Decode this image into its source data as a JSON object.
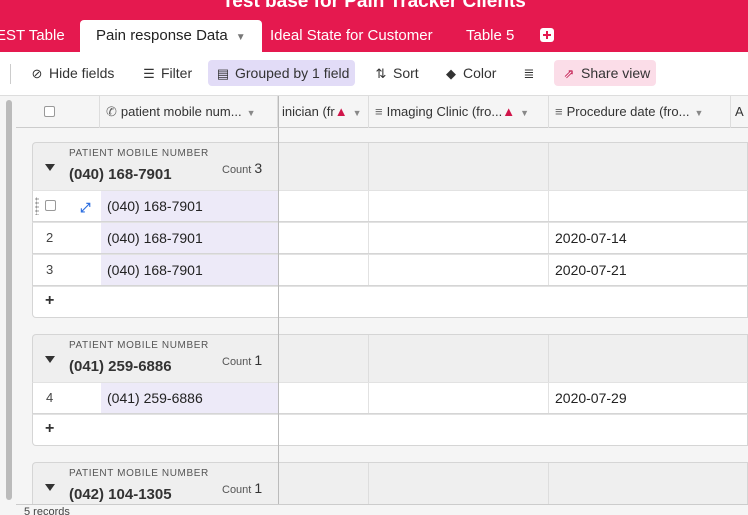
{
  "app": {
    "title": "Test base for Pain Tracker Clients"
  },
  "tabs": [
    {
      "label": "EST Table"
    },
    {
      "label": "Pain response Data"
    },
    {
      "label": "Ideal State for Customer"
    },
    {
      "label": "Table 5"
    }
  ],
  "toolbar": {
    "hide_fields": "Hide fields",
    "filter": "Filter",
    "grouped": "Grouped by 1 field",
    "sort": "Sort",
    "color": "Color",
    "share": "Share view"
  },
  "columns": [
    {
      "label": "patient mobile num..."
    },
    {
      "label": "inician (fr"
    },
    {
      "label": "Imaging Clinic (fro..."
    },
    {
      "label": "Procedure date (fro..."
    },
    {
      "label": "A"
    }
  ],
  "groups": [
    {
      "caption": "PATIENT MOBILE NUMBER",
      "value": "(040) 168-7901",
      "count_label": "Count",
      "count": "3",
      "rows": [
        {
          "num": "",
          "phone": "(040) 168-7901",
          "date": ""
        },
        {
          "num": "2",
          "phone": "(040) 168-7901",
          "date": "2020-07-14"
        },
        {
          "num": "3",
          "phone": "(040) 168-7901",
          "date": "2020-07-21"
        }
      ],
      "add": "+"
    },
    {
      "caption": "PATIENT MOBILE NUMBER",
      "value": "(041) 259-6886",
      "count_label": "Count",
      "count": "1",
      "rows": [
        {
          "num": "4",
          "phone": "(041) 259-6886",
          "date": "2020-07-29"
        }
      ],
      "add": "+"
    },
    {
      "caption": "PATIENT MOBILE NUMBER",
      "value": "(042) 104-1305",
      "count_label": "Count",
      "count": "1"
    }
  ],
  "footer": {
    "records": "5 records"
  },
  "colors": {
    "brand": "#e5194f",
    "grouped_bg": "#e2dcf7",
    "share_bg": "#fbdde8",
    "link": "#2d6fe0"
  }
}
